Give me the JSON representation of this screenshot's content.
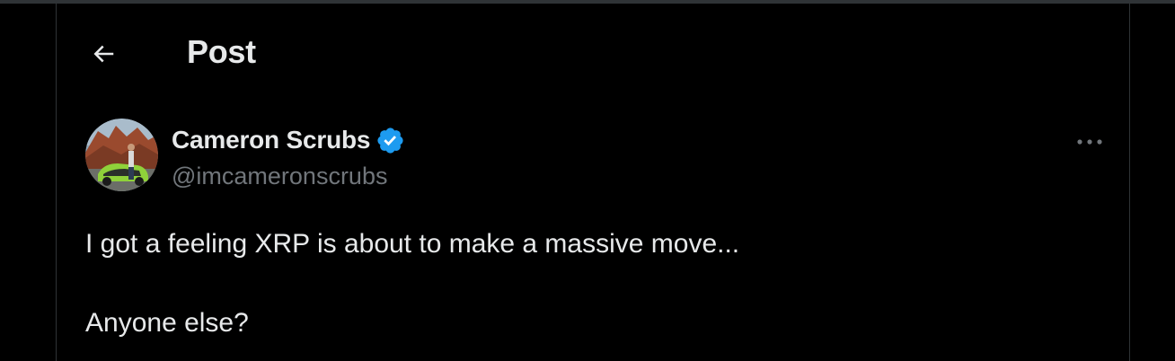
{
  "header": {
    "title": "Post",
    "back_icon": "arrow-left-icon"
  },
  "post": {
    "author": {
      "display_name": "Cameron Scrubs",
      "handle": "@imcameronscrubs",
      "verified": true,
      "verified_color": "#1d9bf0"
    },
    "more_icon": "more-horizontal-icon",
    "text_lines": [
      "I got a feeling XRP is about to make a massive move...",
      "Anyone else?"
    ]
  },
  "colors": {
    "background": "#000000",
    "text_primary": "#e7e9ea",
    "text_secondary": "#71767b",
    "border": "#2f3336",
    "accent": "#1d9bf0"
  }
}
